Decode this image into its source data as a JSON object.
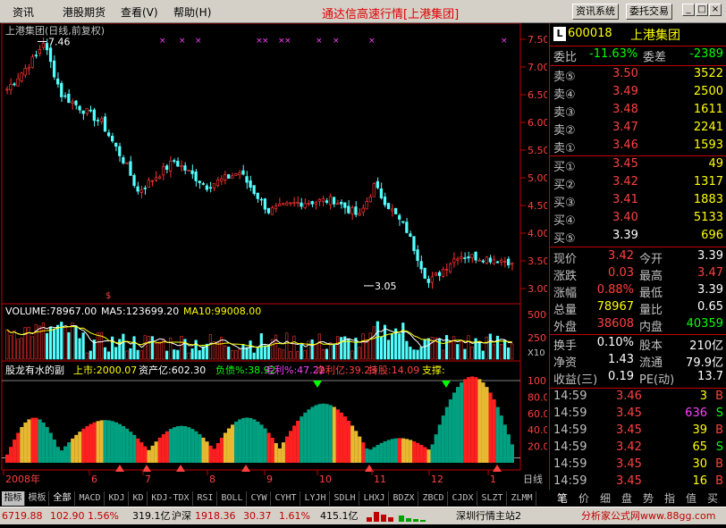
{
  "menu": {
    "items": [
      "资讯",
      "港股期货",
      "查看(V)",
      "帮助(H)"
    ],
    "title": "通达信高速行情[上港集团]",
    "buttons": [
      "资讯系统",
      "委托交易"
    ]
  },
  "chart": {
    "title": "上港集团(日线,前复权)",
    "high_label": "7.46",
    "low_label": "3.05",
    "price_ticks": [
      "7.50",
      "7.00",
      "6.50",
      "6.00",
      "5.50",
      "5.00",
      "4.50",
      "4.00",
      "3.50",
      "3.00"
    ],
    "vol_label": "VOLUME:78967.00",
    "ma5_label": "MA5:123699.20",
    "ma10_label": "MA10:99008.00",
    "vol_ticks": [
      "50000",
      "25000"
    ],
    "vol_unit": "X10",
    "ind_title": "股龙有水的副",
    "ind_items": [
      {
        "t": "上市:2000.07",
        "c": "#ffff00"
      },
      {
        "t": "资产亿:602.30",
        "c": "#ffffff"
      },
      {
        "t": "负债%:38.92",
        "c": "#00ff00"
      },
      {
        "t": "毛利%:47.22",
        "c": "#ff40ff"
      },
      {
        "t": "净利亿:39.23",
        "c": "#ff4040"
      },
      {
        "t": "持股:14.09",
        "c": "#ff4040"
      },
      {
        "t": "支撑:",
        "c": "#ffff00"
      }
    ],
    "ind_ticks": [
      "100.0",
      "80.0",
      "60.0",
      "40.0",
      "20.0"
    ],
    "x_labels": [
      "2008年",
      "6",
      "7",
      "8",
      "9",
      "10",
      "11",
      "12",
      "1"
    ],
    "period": "日线"
  },
  "stock": {
    "code": "600018",
    "name": "上港集团"
  },
  "panel": {
    "wei_bi": {
      "label": "委比",
      "value": "-11.63%"
    },
    "wei_cha": {
      "label": "委差",
      "value": "-2389"
    },
    "asks": [
      {
        "label": "卖⑤",
        "price": "3.50",
        "vol": "3522"
      },
      {
        "label": "卖④",
        "price": "3.49",
        "vol": "2500"
      },
      {
        "label": "卖③",
        "price": "3.48",
        "vol": "1611"
      },
      {
        "label": "卖②",
        "price": "3.47",
        "vol": "2241"
      },
      {
        "label": "卖①",
        "price": "3.46",
        "vol": "1593"
      }
    ],
    "bids": [
      {
        "label": "买①",
        "price": "3.45",
        "vol": "49"
      },
      {
        "label": "买②",
        "price": "3.42",
        "vol": "1317"
      },
      {
        "label": "买③",
        "price": "3.41",
        "vol": "1883"
      },
      {
        "label": "买④",
        "price": "3.40",
        "vol": "5133"
      },
      {
        "label": "买⑤",
        "price": "3.39",
        "vol": "696"
      }
    ],
    "stats": [
      [
        {
          "l": "现价",
          "v": "3.42",
          "c": "#ff4040"
        },
        {
          "l": "今开",
          "v": "3.39",
          "c": "#ffffff"
        }
      ],
      [
        {
          "l": "涨跌",
          "v": "0.03",
          "c": "#ff4040"
        },
        {
          "l": "最高",
          "v": "3.47",
          "c": "#ff4040"
        }
      ],
      [
        {
          "l": "涨幅",
          "v": "0.88%",
          "c": "#ff4040"
        },
        {
          "l": "最低",
          "v": "3.39",
          "c": "#ffffff"
        }
      ],
      [
        {
          "l": "总量",
          "v": "78967",
          "c": "#ffff00"
        },
        {
          "l": "量比",
          "v": "0.65",
          "c": "#ffffff"
        }
      ],
      [
        {
          "l": "外盘",
          "v": "38608",
          "c": "#ff4040"
        },
        {
          "l": "内盘",
          "v": "40359",
          "c": "#00ff00"
        }
      ]
    ],
    "stats2": [
      [
        {
          "l": "换手",
          "v": "0.10%",
          "c": "#ffffff"
        },
        {
          "l": "股本",
          "v": "210亿",
          "c": "#ffffff"
        }
      ],
      [
        {
          "l": "净资",
          "v": "1.43",
          "c": "#ffffff"
        },
        {
          "l": "流通",
          "v": "79.9亿",
          "c": "#ffffff"
        }
      ],
      [
        {
          "l": "收益(三)",
          "v": "0.19",
          "c": "#ffffff"
        },
        {
          "l": "PE(动)",
          "v": "13.7",
          "c": "#ffffff"
        }
      ]
    ],
    "ticks": [
      {
        "t": "14:59",
        "p": "3.46",
        "v": "3",
        "s": "B",
        "pc": "#ff4040",
        "sc": "#ff4040",
        "vc": "#ffff00"
      },
      {
        "t": "14:59",
        "p": "3.45",
        "v": "636",
        "s": "S",
        "pc": "#ff4040",
        "sc": "#00ff00",
        "vc": "#ff40ff"
      },
      {
        "t": "14:59",
        "p": "3.45",
        "v": "39",
        "s": "B",
        "pc": "#ff4040",
        "sc": "#ff4040",
        "vc": "#ffff00"
      },
      {
        "t": "14:59",
        "p": "3.42",
        "v": "65",
        "s": "S",
        "pc": "#ff4040",
        "sc": "#00ff00",
        "vc": "#ffff00"
      },
      {
        "t": "14:59",
        "p": "3.45",
        "v": "30",
        "s": "B",
        "pc": "#ff4040",
        "sc": "#ff4040",
        "vc": "#ffff00"
      },
      {
        "t": "14:59",
        "p": "3.45",
        "v": "16",
        "s": "B",
        "pc": "#ff4040",
        "sc": "#ff4040",
        "vc": "#ffff00"
      }
    ]
  },
  "tabs": [
    "指标",
    "模板",
    "全部",
    "MACD",
    "KDJ",
    "KD",
    "KDJ-TDX",
    "RSI",
    "BOLL",
    "CYW",
    "CYHT",
    "LYJH",
    "SDLH",
    "LHXJ",
    "BDZX",
    "ZBCD",
    "CJDX",
    "SLZT",
    "ZLMM"
  ],
  "rtabs": [
    "笔",
    "价",
    "细",
    "盘",
    "势",
    "指",
    "值",
    "买"
  ],
  "status": {
    "sh_idx": "6719.88",
    "sh_chg": "102.90",
    "sh_pct": "1.56%",
    "sh_amt": "319.1亿",
    "sz_name": "沪深",
    "sz_idx": "1918.36",
    "sz_chg": "30.37",
    "sz_pct": "1.61%",
    "sz_amt": "415.1亿",
    "server": "深圳行情主站2",
    "site": "分析家公式网www.88gg.com"
  },
  "colors": {
    "up": "#ff3232",
    "down": "#54ffff",
    "border": "#c00000"
  }
}
